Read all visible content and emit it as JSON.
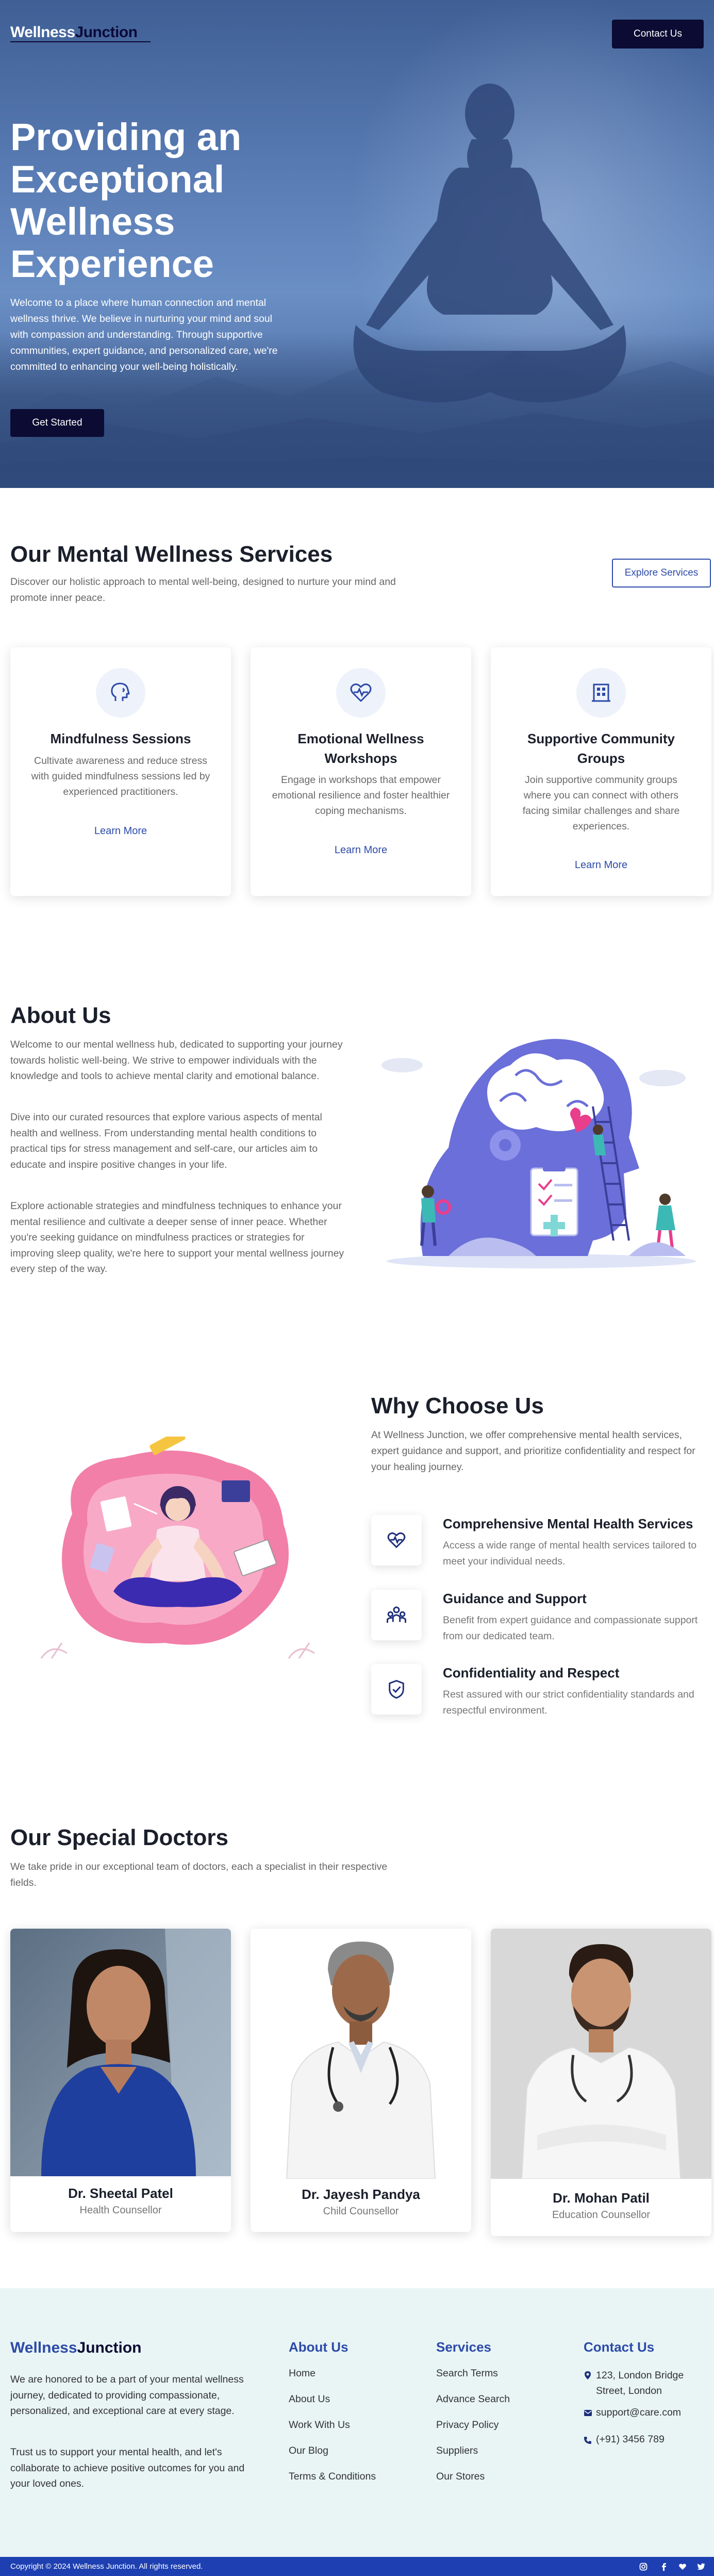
{
  "brand": {
    "part1": "Wellness",
    "part2": "Junction"
  },
  "nav": {
    "contact_label": "Contact Us"
  },
  "hero": {
    "title": "Providing an Exceptional Wellness Experience",
    "text": "Welcome to a place where human connection and mental wellness thrive. We believe in nurturing your mind and soul with compassion and understanding. Through supportive communities, expert guidance, and personalized care, we're committed to enhancing your well-being holistically.",
    "cta": "Get Started"
  },
  "services": {
    "title": "Our Mental Wellness Services",
    "subtitle": "Discover our holistic approach to mental well-being, designed to nurture your mind and promote inner peace.",
    "explore": "Explore Services",
    "cards": [
      {
        "icon": "speech-head-icon",
        "title": "Mindfulness Sessions",
        "text": "Cultivate awareness and reduce stress with guided mindfulness sessions led by experienced practitioners.",
        "link": "Learn More"
      },
      {
        "icon": "heart-pulse-icon",
        "title": "Emotional Wellness Workshops",
        "text": "Engage in workshops that empower emotional resilience and foster healthier coping mechanisms.",
        "link": "Learn More"
      },
      {
        "icon": "community-building-icon",
        "title": "Supportive Community Groups",
        "text": "Join supportive community groups where you can connect with others facing similar challenges and share experiences.",
        "link": "Learn More"
      }
    ]
  },
  "about": {
    "title": "About Us",
    "p1": "Welcome to our mental wellness hub, dedicated to supporting your journey towards holistic well-being. We strive to empower individuals with the knowledge and tools to achieve mental clarity and emotional balance.",
    "p2": "Dive into our curated resources that explore various aspects of mental health and wellness. From understanding mental health conditions to practical tips for stress management and self-care, our articles aim to educate and inspire positive changes in your life.",
    "p3": "Explore actionable strategies and mindfulness techniques to enhance your mental resilience and cultivate a deeper sense of inner peace. Whether you're seeking guidance on mindfulness practices or strategies for improving sleep quality, we're here to support your mental wellness journey every step of the way."
  },
  "why": {
    "title": "Why Choose Us",
    "subtitle": "At Wellness Junction, we offer comprehensive mental health services, expert guidance and support, and prioritize confidentiality and respect for your healing journey.",
    "features": [
      {
        "icon": "heart-pulse-icon",
        "title": "Comprehensive Mental Health Services",
        "text": "Access a wide range of mental health services tailored to meet your individual needs."
      },
      {
        "icon": "people-group-icon",
        "title": "Guidance and Support",
        "text": "Benefit from expert guidance and compassionate support from our dedicated team."
      },
      {
        "icon": "shield-check-icon",
        "title": "Confidentiality and Respect",
        "text": "Rest assured with our strict confidentiality standards and respectful environment."
      }
    ]
  },
  "doctors": {
    "title": "Our Special Doctors",
    "subtitle": "We take pride in our exceptional team of doctors, each a specialist in their respective fields.",
    "list": [
      {
        "name": "Dr. Sheetal Patel",
        "role": "Health Counsellor"
      },
      {
        "name": "Dr. Jayesh Pandya",
        "role": "Child Counsellor"
      },
      {
        "name": "Dr. Mohan Patil",
        "role": "Education Counsellor"
      }
    ]
  },
  "footer": {
    "p1": "We are honored to be a part of your mental wellness journey, dedicated to providing compassionate, personalized, and exceptional care at every stage.",
    "p2": "Trust us to support your mental health, and let's collaborate to achieve positive outcomes for you and your loved ones.",
    "about_title": "About Us",
    "about_links": [
      "Home",
      "About Us",
      "Work With Us",
      "Our Blog",
      "Terms & Conditions"
    ],
    "services_title": "Services",
    "services_links": [
      "Search Terms",
      "Advance Search",
      "Privacy Policy",
      "Suppliers",
      "Our Stores"
    ],
    "contact_title": "Contact Us",
    "address": "123, London Bridge Street, London",
    "email": "support@care.com",
    "phone": "(+91) 3456 789",
    "copyright": "Copyright © 2024 Wellness Junction. All rights reserved."
  },
  "colors": {
    "navy": "#0b0b33",
    "accent": "#2d4aa8",
    "footer_bg": "#e9f5f5",
    "bottom_bar": "#1d3fb1"
  }
}
